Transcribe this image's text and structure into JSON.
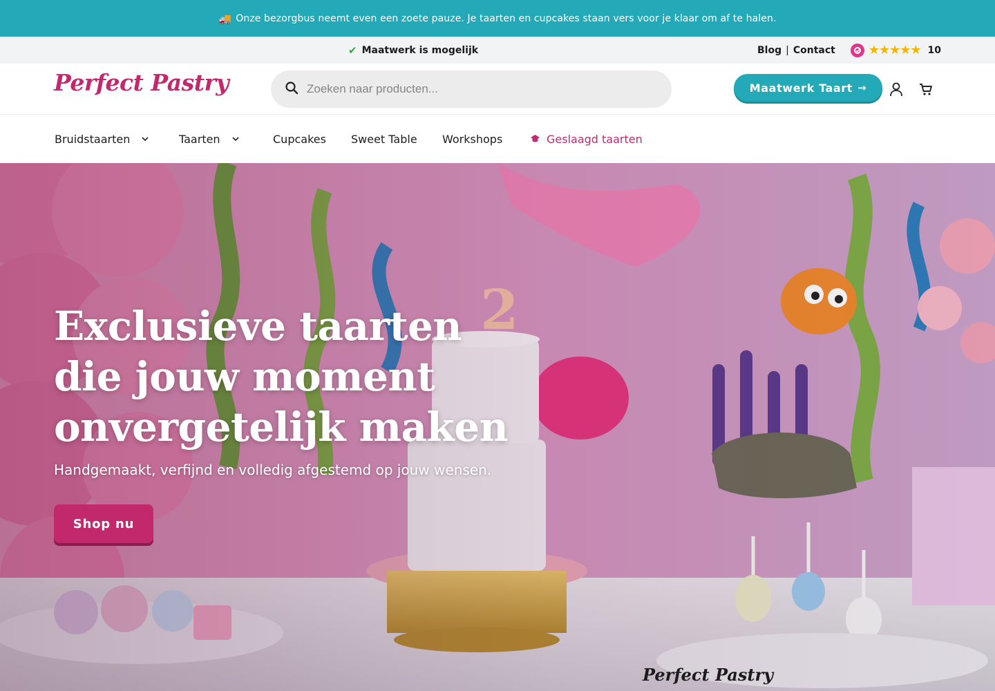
{
  "announcement": {
    "icon": "truck-icon",
    "text": "Onze bezorgbus neemt even een zoete pauze. Je taarten en cupcakes staan vers voor je klaar om af te halen."
  },
  "utility": {
    "usp": "Maatwerk is mogelijk",
    "blog": "Blog",
    "separator": "|",
    "contact": "Contact",
    "rating_score": "10",
    "stars": "★★★★★"
  },
  "header": {
    "logo": "Perfect Pastry",
    "search_placeholder": "Zoeken naar producten...",
    "cta": "Maatwerk Taart",
    "cta_arrow": "→"
  },
  "nav": {
    "items": [
      {
        "label": "Bruidstaarten",
        "dropdown": true
      },
      {
        "label": "Taarten",
        "dropdown": true
      },
      {
        "label": "Cupcakes"
      },
      {
        "label": "Sweet Table"
      },
      {
        "label": "Workshops"
      },
      {
        "label": "Geslaagd taarten",
        "highlight": true
      }
    ]
  },
  "hero": {
    "title": "Exclusieve taarten die jouw moment onvergetelijk maken",
    "subtitle": "Handgemaakt, verfijnd en volledig afgestemd op jouw wensen.",
    "button": "Shop nu",
    "watermark": "Perfect Pastry"
  },
  "colors": {
    "teal": "#23a9b7",
    "brand_pink": "#c2296d",
    "star": "#f5b400",
    "check": "#2eaa3a"
  }
}
